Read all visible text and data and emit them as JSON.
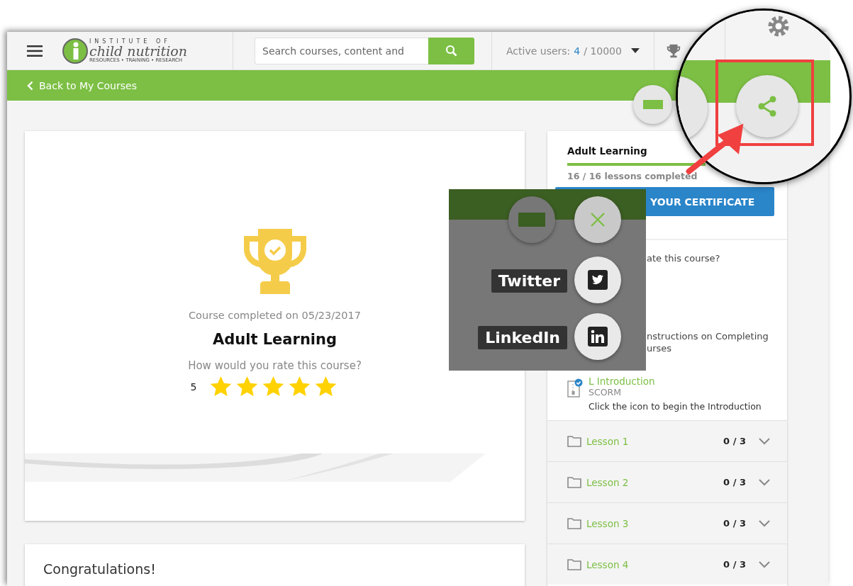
{
  "header": {
    "logo": {
      "top": "INSTITUTE OF",
      "name": "child nutrition",
      "tagline": "RESOURCES • TRAINING • RESEARCH"
    },
    "search": {
      "placeholder": "Search courses, content and"
    },
    "active_users": {
      "label": "Active users:",
      "count": "4",
      "total": "/ 10000"
    }
  },
  "back_link": "Back to My Courses",
  "course_card": {
    "completed": "Course completed on 05/23/2017",
    "title": "Adult Learning",
    "rating_prompt": "How would you rate this course?",
    "rating_value": "5",
    "stars": 5
  },
  "congrats_card": {
    "title": "Congratulations!"
  },
  "sidebar": {
    "title": "Adult Learning",
    "level": 1,
    "progress_text": "16 / 16 lessons completed",
    "certificate_button": "YOUR CERTIFICATE",
    "rate_text": "ate this course?",
    "instructions_lines": [
      "nstructions on Completing",
      "urses"
    ],
    "intro": {
      "title": "L Introduction",
      "type": "SCORM",
      "description": "Click the icon to begin the Introduction",
      "completed": true
    },
    "lessons": [
      {
        "name": "Lesson 1",
        "count": "0 / 3",
        "expanded": false
      },
      {
        "name": "Lesson 2",
        "count": "0 / 3",
        "expanded": false
      },
      {
        "name": "Lesson 3",
        "count": "0 / 3",
        "expanded": false
      },
      {
        "name": "Lesson 4",
        "count": "0 / 3",
        "expanded": false
      }
    ]
  },
  "share_popup": {
    "items": [
      {
        "kind": "twitter",
        "label": "Twitter"
      },
      {
        "kind": "linkedin",
        "label": "LinkedIn"
      }
    ]
  }
}
